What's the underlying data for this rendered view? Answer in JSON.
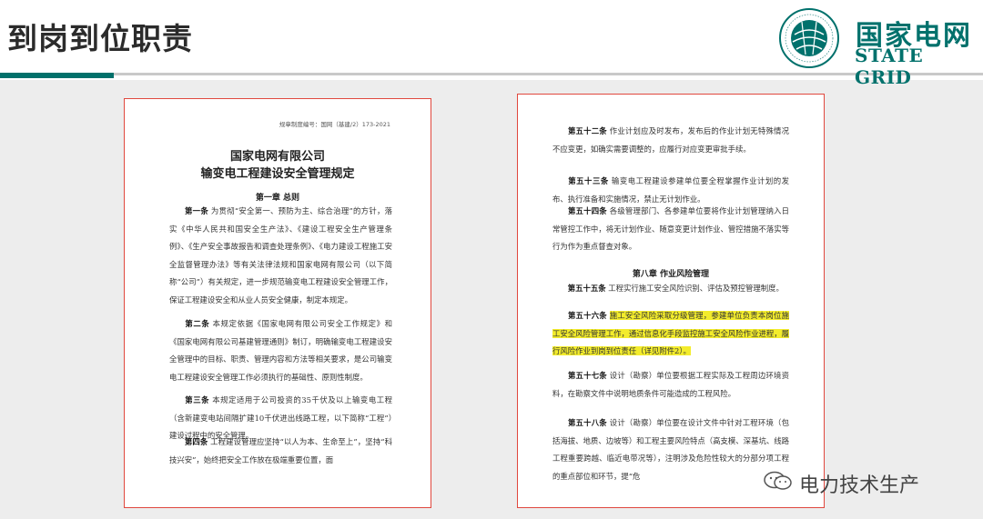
{
  "header": {
    "title": "到岗到位职责"
  },
  "logo": {
    "cn": "国家电网",
    "en": "STATE GRID",
    "seal_text": "国家电网公司 STATE GRID CORPORATION OF CHINA"
  },
  "doc_left": {
    "code": "规章制度编号：国网（基建/2）173-2021",
    "org": "国家电网有限公司",
    "title": "输变电工程建设安全管理规定",
    "chapter": "第一章 总则",
    "articles": [
      {
        "label": "第一条",
        "text": "为贯彻“安全第一、预防为主、综合治理”的方针，落实《中华人民共和国安全生产法》、《建设工程安全生产管理条例》、《生产安全事故报告和调查处理条例》、《电力建设工程施工安全监督管理办法》等有关法律法规和国家电网有限公司（以下简称“公司”）有关规定，进一步规范输变电工程建设安全管理工作，保证工程建设安全和从业人员安全健康，制定本规定。"
      },
      {
        "label": "第二条",
        "text": "本规定依据《国家电网有限公司安全工作规定》和《国家电网有限公司基建管理通则》制订，明确输变电工程建设安全管理中的目标、职责、管理内容和方法等相关要求，是公司输变电工程建设安全管理工作必须执行的基础性、原则性制度。"
      },
      {
        "label": "第三条",
        "text": "本规定适用于公司投资的35千伏及以上输变电工程（含新建变电站间隔扩建10千伏进出线路工程，以下简称“工程”）建设过程中的安全管理。"
      },
      {
        "label": "第四条",
        "text": "工程建设管理应坚持“以人为本、生命至上”，坚持“科技兴安”，始终把安全工作放在极端重要位置，面"
      }
    ]
  },
  "doc_right": {
    "articles_top": [
      {
        "label": "第五十二条",
        "text": "作业计划应及时发布，发布后的作业计划无特殊情况不应变更，如确实需要调整的，应履行对应变更审批手续。"
      },
      {
        "label": "第五十三条",
        "text": "输变电工程建设参建单位要全程掌握作业计划的发布、执行准备和实施情况，禁止无计划作业。"
      },
      {
        "label": "第五十四条",
        "text": "各级管理部门、各参建单位要将作业计划管理纳入日常管控工作中，将无计划作业、随意变更计划作业、管控措施不落实等行为作为重点督查对象。"
      }
    ],
    "chapter": "第八章 作业风险管理",
    "articles_bottom": [
      {
        "label": "第五十五条",
        "text": "工程实行施工安全风险识别、评估及预控管理制度。"
      },
      {
        "label": "第五十六条",
        "text": "施工安全风险采取分级管理，参建单位负责本岗位施工安全风险管理工作，通过信息化手段监控施工安全风险作业进程，履行风险作业到岗到位责任（详见附件2）。",
        "highlight": true
      },
      {
        "label": "第五十七条",
        "text": "设计（勘察）单位要根据工程实际及工程周边环境资料，在勘察文件中说明地质条件可能造成的工程风险。"
      },
      {
        "label": "第五十八条",
        "text": "设计（勘察）单位要在设计文件中针对工程环境（包括海拔、地质、边坡等）和工程主要风险特点（高支模、深基坑、线路工程重要跨越、临近电带况等），注明涉及危险性较大的分部分项工程的重点部位和环节，提“危"
      }
    ]
  },
  "watermark": {
    "text": "电力技术生产"
  },
  "colors": {
    "brand": "#00716c",
    "frame": "#e0483e",
    "highlight": "#f3ec2c"
  }
}
